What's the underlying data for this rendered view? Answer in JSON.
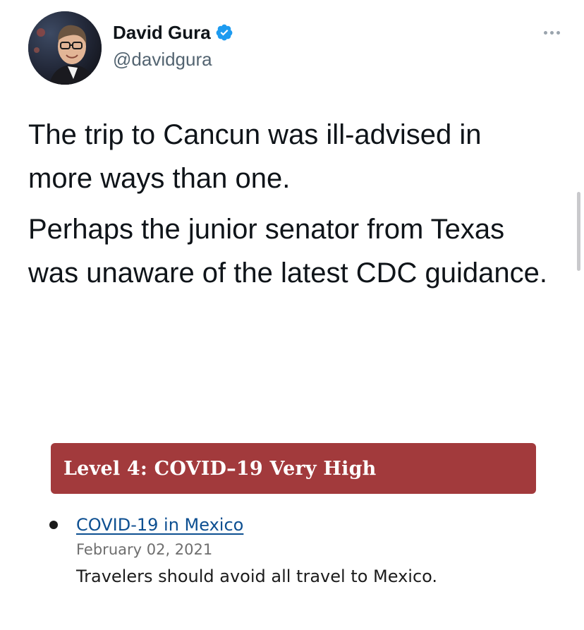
{
  "author": {
    "display_name": "David Gura",
    "handle": "@davidgura",
    "verified": true
  },
  "tweet": {
    "paragraphs": [
      "The trip to Cancun was ill-advised in more ways than one.",
      "Perhaps the junior senator from Texas was unaware of the latest CDC guidance."
    ]
  },
  "attachment": {
    "advisory_level": "Level 4: COVID–19 Very High",
    "link_text": "COVID-19 in Mexico",
    "date": "February 02, 2021",
    "note": "Travelers should avoid all travel to Mexico.",
    "colors": {
      "banner": "#a23a3c",
      "link": "#0d4f91"
    }
  },
  "colors": {
    "verified_badge": "#1d9bf0",
    "handle": "#536471"
  },
  "icons": {
    "verified": "verified-badge-icon",
    "more": "more-options-icon"
  }
}
